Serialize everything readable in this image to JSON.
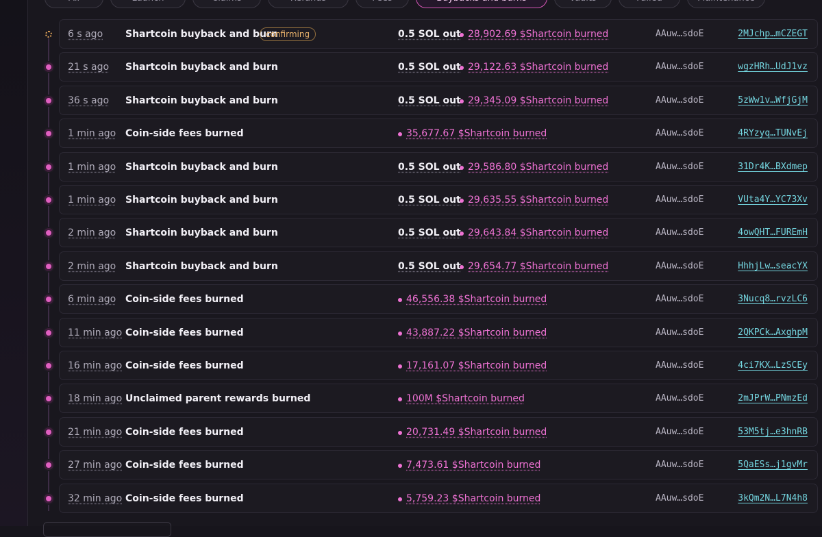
{
  "filters": [
    {
      "label": "All"
    },
    {
      "label": "Launch"
    },
    {
      "label": "Claims"
    },
    {
      "label": "Refunds"
    },
    {
      "label": "Fees"
    },
    {
      "label": "Buybacks and burns",
      "active": true
    },
    {
      "label": "Vaults"
    },
    {
      "label": "Failed"
    },
    {
      "label": "Maintenance"
    }
  ],
  "rows": [
    {
      "time": "6 s ago",
      "title": "Shartcoin buyback and burn",
      "badge": "confirming",
      "sol": "0.5 SOL out",
      "burn": "28,902.69 $Shartcoin burned",
      "addr": "AAuw…sdoE",
      "tx": "2MJchp…mCZEGT",
      "pending": true
    },
    {
      "time": "21 s ago",
      "title": "Shartcoin buyback and burn",
      "sol": "0.5 SOL out",
      "burn": "29,122.63 $Shartcoin burned",
      "addr": "AAuw…sdoE",
      "tx": "wgzHRh…UdJ1vz"
    },
    {
      "time": "36 s ago",
      "title": "Shartcoin buyback and burn",
      "sol": "0.5 SOL out",
      "burn": "29,345.09 $Shartcoin burned",
      "addr": "AAuw…sdoE",
      "tx": "5zWw1v…WfjGjM"
    },
    {
      "time": "1 min ago",
      "title": "Coin-side fees burned",
      "burn": "35,677.67 $Shartcoin burned",
      "addr": "AAuw…sdoE",
      "tx": "4RYzyq…TUNvEj"
    },
    {
      "time": "1 min ago",
      "title": "Shartcoin buyback and burn",
      "sol": "0.5 SOL out",
      "burn": "29,586.80 $Shartcoin burned",
      "addr": "AAuw…sdoE",
      "tx": "31Dr4K…BXdmep"
    },
    {
      "time": "1 min ago",
      "title": "Shartcoin buyback and burn",
      "sol": "0.5 SOL out",
      "burn": "29,635.55 $Shartcoin burned",
      "addr": "AAuw…sdoE",
      "tx": "VUta4Y…YC73Xv"
    },
    {
      "time": "2 min ago",
      "title": "Shartcoin buyback and burn",
      "sol": "0.5 SOL out",
      "burn": "29,643.84 $Shartcoin burned",
      "addr": "AAuw…sdoE",
      "tx": "4owQHT…FUREmH"
    },
    {
      "time": "2 min ago",
      "title": "Shartcoin buyback and burn",
      "sol": "0.5 SOL out",
      "burn": "29,654.77 $Shartcoin burned",
      "addr": "AAuw…sdoE",
      "tx": "HhhjLw…seacYX"
    },
    {
      "time": "6 min ago",
      "title": "Coin-side fees burned",
      "burn": "46,556.38 $Shartcoin burned",
      "addr": "AAuw…sdoE",
      "tx": "3Nucq8…rvzLC6"
    },
    {
      "time": "11 min ago",
      "title": "Coin-side fees burned",
      "burn": "43,887.22 $Shartcoin burned",
      "addr": "AAuw…sdoE",
      "tx": "2QKPCk…AxghpM"
    },
    {
      "time": "16 min ago",
      "title": "Coin-side fees burned",
      "burn": "17,161.07 $Shartcoin burned",
      "addr": "AAuw…sdoE",
      "tx": "4ci7KX…LzSCEy"
    },
    {
      "time": "18 min ago",
      "title": "Unclaimed parent rewards burned",
      "burn": "100M $Shartcoin burned",
      "addr": "AAuw…sdoE",
      "tx": "2mJPrW…PNmzEd"
    },
    {
      "time": "21 min ago",
      "title": "Coin-side fees burned",
      "burn": "20,731.49 $Shartcoin burned",
      "addr": "AAuw…sdoE",
      "tx": "53M5tj…e3hnRB"
    },
    {
      "time": "27 min ago",
      "title": "Coin-side fees burned",
      "burn": "7,473.61 $Shartcoin burned",
      "addr": "AAuw…sdoE",
      "tx": "5QaESs…j1gvMr"
    },
    {
      "time": "32 min ago",
      "title": "Coin-side fees burned",
      "burn": "5,759.23 $Shartcoin burned",
      "addr": "AAuw…sdoE",
      "tx": "3kQm2N…L7N4h8"
    }
  ]
}
